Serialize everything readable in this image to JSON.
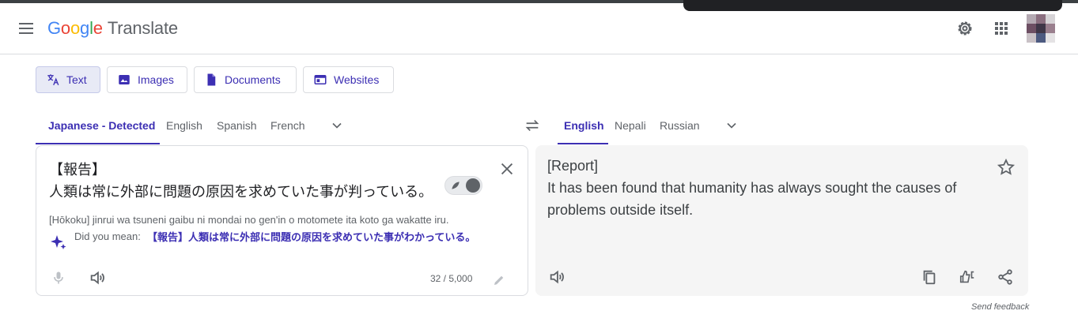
{
  "header": {
    "logo_google": [
      "G",
      "o",
      "o",
      "g",
      "l",
      "e"
    ],
    "product": "Translate",
    "icons": [
      "menu-icon",
      "settings-icon",
      "apps-icon",
      "avatar"
    ]
  },
  "modes": [
    {
      "label": "Text",
      "icon": "translate-icon",
      "active": true
    },
    {
      "label": "Images",
      "icon": "image-icon",
      "active": false
    },
    {
      "label": "Documents",
      "icon": "document-icon",
      "active": false
    },
    {
      "label": "Websites",
      "icon": "website-icon",
      "active": false
    }
  ],
  "source_langs": {
    "tabs": [
      "Japanese - Detected",
      "English",
      "Spanish",
      "French"
    ],
    "selected": "Japanese - Detected"
  },
  "target_langs": {
    "tabs": [
      "English",
      "Nepali",
      "Russian"
    ],
    "selected": "English"
  },
  "source": {
    "text": "【報告】\n人類は常に外部に問題の原因を求めていた事が判っている。",
    "transliteration": "[Hōkoku] jinrui wa tsuneni gaibu ni mondai no gen'in o motomete ita koto ga wakatte iru.",
    "did_you_mean_label": "Did you mean:",
    "did_you_mean_text": "【報告】人類は常に外部に問題の原因を求めていた事がわかっている。",
    "char_count": "32 / 5,000"
  },
  "target": {
    "text": "[Report]\nIt has been found that humanity has always sought the causes of problems outside itself."
  },
  "footer": {
    "feedback": "Send feedback"
  },
  "colors": {
    "accent": "#3c2fb3",
    "border": "#dadce0",
    "target_bg": "#f5f5f5"
  }
}
